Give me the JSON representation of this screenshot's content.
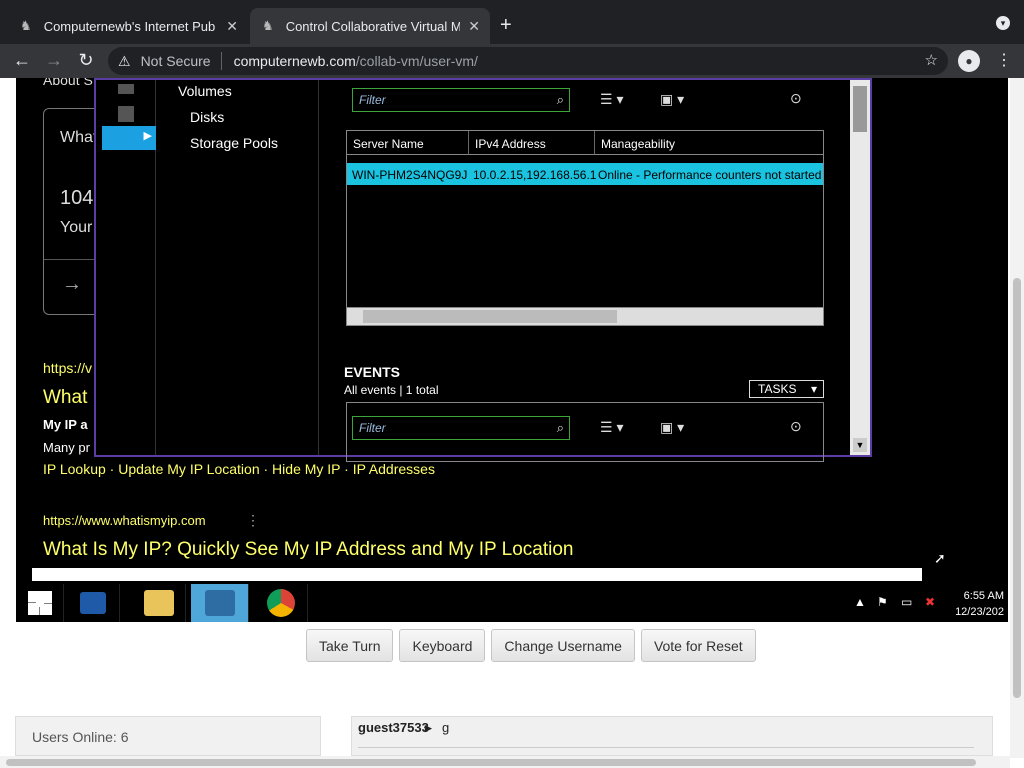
{
  "browser": {
    "tabs": [
      {
        "title": "Computernewb's Internet Pub",
        "active": false
      },
      {
        "title": "Control Collaborative Virtual M",
        "active": true
      }
    ],
    "security": "Not Secure",
    "url_host": "computernewb.com",
    "url_path": "/collab-vm/user-vm/"
  },
  "vm_page": {
    "about_snippet": "About S",
    "card": {
      "line1": "What",
      "number": "104",
      "line2": "Your"
    },
    "result1": {
      "url": "https://v",
      "title": "What",
      "bold": "My IP a",
      "desc": "Many pr",
      "links": "IP Lookup · Update My IP Location · Hide My IP · IP Addresses"
    },
    "result2": {
      "url": "https://www.whatismyip.com",
      "title": "What Is My IP? Quickly See My IP Address and My IP Location"
    }
  },
  "server_manager": {
    "tree": [
      "Volumes",
      "Disks",
      "Storage Pools"
    ],
    "filter_placeholder": "Filter",
    "columns": [
      "Server Name",
      "IPv4 Address",
      "Manageability"
    ],
    "rows": [
      {
        "server": "WIN-PHM2S4NQG9J",
        "ipv4": "10.0.2.15,192.168.56.1",
        "manageability": "Online - Performance counters not started"
      }
    ],
    "events_title": "EVENTS",
    "events_sub": "All events | 1 total",
    "tasks_label": "TASKS"
  },
  "taskbar": {
    "time": "6:55 AM",
    "date": "12/23/202"
  },
  "vm_controls": {
    "take_turn": "Take Turn",
    "keyboard": "Keyboard",
    "change_username": "Change Username",
    "vote_reset": "Vote for Reset"
  },
  "users_online": "Users Online: 6",
  "chat": {
    "user": "guest37533",
    "message": "g"
  }
}
